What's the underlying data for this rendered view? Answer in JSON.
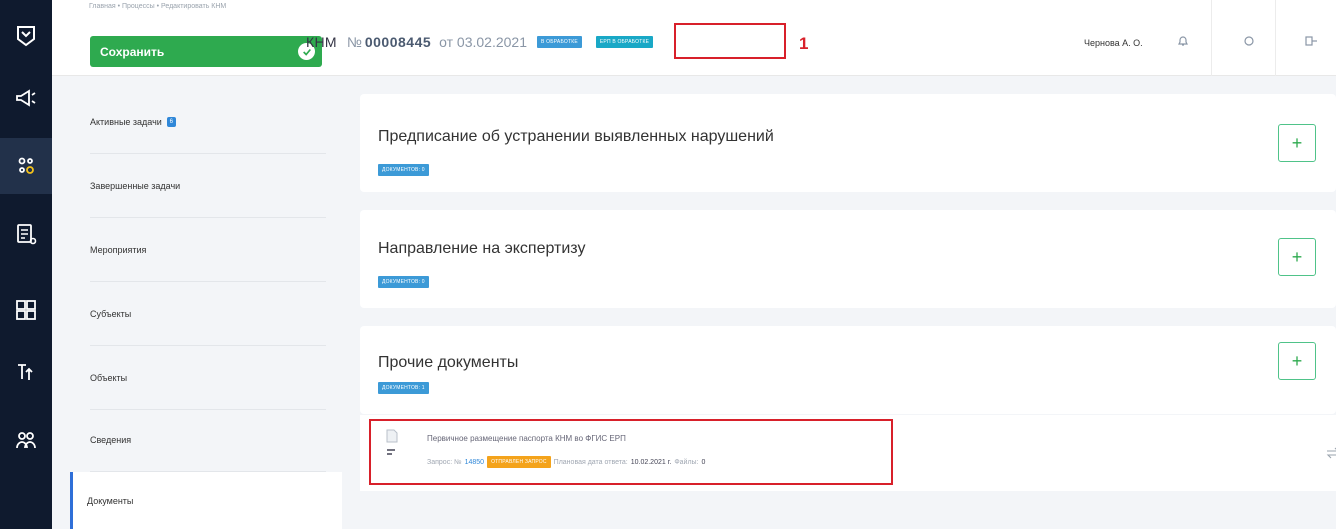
{
  "rail": {
    "icons": [
      "home-icon",
      "megaphone-icon",
      "processes-icon",
      "registry-icon",
      "modules-icon",
      "analytics-icon",
      "users-icon"
    ]
  },
  "topbar": {
    "breadcrumb": "Главная  •  Процессы  •  Редактировать КНМ",
    "save_label": "Сохранить",
    "title_kind": "КНМ",
    "title_no_label": "№",
    "title_number": "00008445",
    "title_from": "от 03.02.2021",
    "status_badge": "в обработке",
    "erp_badge": "ЕРП в обработке",
    "callout_number": "1",
    "user_name": "Чернова А. О."
  },
  "sidebar": {
    "items": [
      {
        "label": "Активные задачи",
        "count": "6"
      },
      {
        "label": "Завершенные задачи"
      },
      {
        "label": "Мероприятия"
      },
      {
        "label": "Субъекты"
      },
      {
        "label": "Объекты"
      },
      {
        "label": "Сведения"
      }
    ],
    "active_item": "Документы"
  },
  "main": {
    "cards": [
      {
        "title": "Предписание об устранении выявленных нарушений",
        "badge": "Документов: 0"
      },
      {
        "title": "Направление на экспертизу",
        "badge": "Документов: 0"
      },
      {
        "title": "Прочие документы",
        "badge": "Документов: 1"
      }
    ],
    "doc": {
      "title": "Первичное размещение паспорта КНМ во ФГИС ЕРП",
      "request_label": "Запрос: №",
      "request_no": "14850",
      "status": "Отправлен запрос",
      "due_label": "Плановая дата ответа:",
      "due_date": "10.02.2021 г.",
      "files_label": "Файлы:",
      "files_count": "0"
    }
  },
  "colors": {
    "accent_green": "#2eaa4f",
    "highlight_red": "#d8202a",
    "rail_bg": "#0f1a2e"
  }
}
